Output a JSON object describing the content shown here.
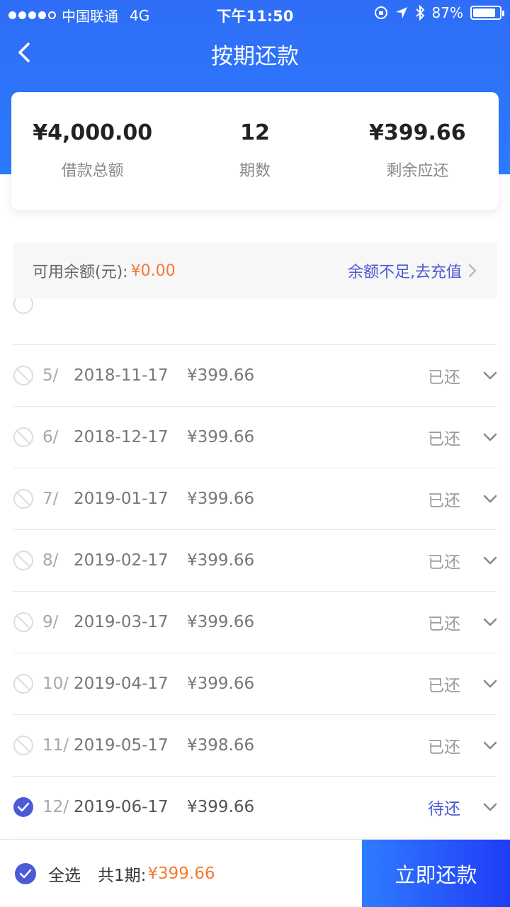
{
  "status_bar": {
    "carrier": "中国联通",
    "network": "4G",
    "time": "下午11:50",
    "battery": "87%",
    "battery_level": 0.87
  },
  "nav": {
    "title": "按期还款"
  },
  "summary": {
    "total_amount": "¥4,000.00",
    "total_label": "借款总额",
    "periods": "12",
    "periods_label": "期数",
    "remaining": "¥399.66",
    "remaining_label": "剩余应还"
  },
  "balance": {
    "label": "可用余额(元):",
    "amount": "¥0.00",
    "recharge": "余额不足,去充值"
  },
  "installments": [
    {
      "period": "5/",
      "date": "2018-11-17",
      "amount": "¥399.66",
      "status": "已还"
    },
    {
      "period": "6/",
      "date": "2018-12-17",
      "amount": "¥399.66",
      "status": "已还"
    },
    {
      "period": "7/",
      "date": "2019-01-17",
      "amount": "¥399.66",
      "status": "已还"
    },
    {
      "period": "8/",
      "date": "2019-02-17",
      "amount": "¥399.66",
      "status": "已还"
    },
    {
      "period": "9/",
      "date": "2019-03-17",
      "amount": "¥399.66",
      "status": "已还"
    },
    {
      "period": "10/",
      "date": "2019-04-17",
      "amount": "¥399.66",
      "status": "已还"
    },
    {
      "period": "11/",
      "date": "2019-05-17",
      "amount": "¥398.66",
      "status": "已还"
    },
    {
      "period": "12/",
      "date": "2019-06-17",
      "amount": "¥399.66",
      "status": "待还"
    }
  ],
  "footer": {
    "select_all": "全选",
    "total_label": "共1期:",
    "total_amount": "¥399.66",
    "pay_button": "立即还款"
  },
  "colors": {
    "brand": "#2f6df6",
    "accent_orange": "#f47a2f",
    "link_blue": "#4b5bd6"
  }
}
